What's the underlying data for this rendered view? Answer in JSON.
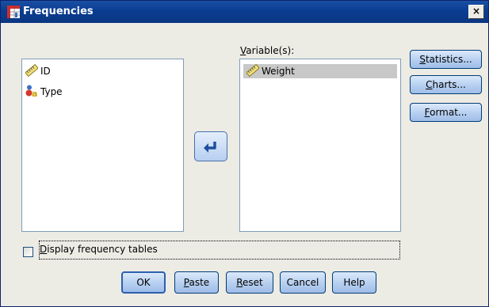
{
  "window": {
    "title": "Frequencies",
    "close_label": "×"
  },
  "source_list": {
    "items": [
      {
        "label": "ID",
        "icon": "ruler-scale-icon"
      },
      {
        "label": "Type",
        "icon": "nominal-variable-icon"
      }
    ]
  },
  "target_list": {
    "label_prefix": "V",
    "label_rest": "ariable(s):",
    "items": [
      {
        "label": "Weight",
        "icon": "ruler-scale-icon",
        "selected": true
      }
    ]
  },
  "side_buttons": {
    "statistics_u": "S",
    "statistics_rest": "tatistics...",
    "charts_u": "C",
    "charts_rest": "harts...",
    "format_u": "F",
    "format_rest": "ormat..."
  },
  "move_button": {
    "icon": "move-arrow-icon"
  },
  "checkbox": {
    "label_u": "D",
    "label_rest": "isplay frequency tables",
    "checked": false
  },
  "bottom_buttons": {
    "ok": "OK",
    "paste_u": "P",
    "paste_rest": "aste",
    "reset_u": "R",
    "reset_rest": "eset",
    "cancel": "Cancel",
    "help": "Help"
  },
  "colors": {
    "titlebar": "#0a3d91",
    "dialog_bg": "#ecebe4",
    "button_border": "#003c74",
    "selected_item": "#c8c8c8"
  }
}
